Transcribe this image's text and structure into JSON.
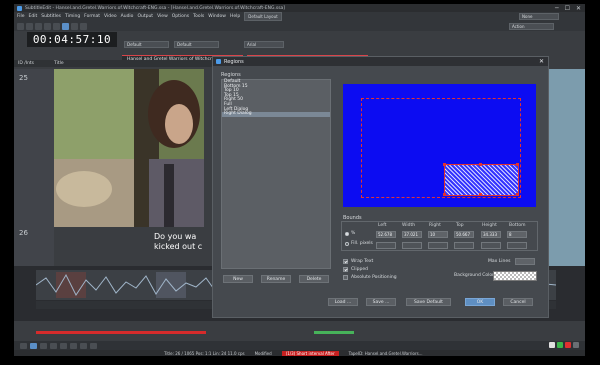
{
  "window": {
    "title": "SubtitleEdit - Hansel.and.Gretel.Warriors.of.Witchcraft-ENG.ssa - [Hansel.and.Gretel.Warriors.of.Witchcraft-ENG.ssa]",
    "minimize": "─",
    "maximize": "☐",
    "close": "✕"
  },
  "menu": {
    "items": [
      "File",
      "Edit",
      "Subtitles",
      "Timing",
      "Format",
      "Video",
      "Audio",
      "Output",
      "View",
      "Options",
      "Tools",
      "Window",
      "Help"
    ],
    "layout_select": "Default Layout",
    "right_select": "None",
    "action_select": "Action"
  },
  "timecode": "00:04:57:10",
  "tabs": [
    "Hansel and Gretel Warriors of Witchcraft-ENG.ssa",
    "Hansel and Gretel Warriors of Witchcraft-ENG.ssa"
  ],
  "style_selects": {
    "style": "Default",
    "font": "Default",
    "font_name": "Arial"
  },
  "grid_header": {
    "id": "ID /Ints",
    "title": "Title"
  },
  "rows": {
    "row1_num": "25",
    "row2_num": "26"
  },
  "subtitle_lines": {
    "line1": "Do you wa",
    "line2": "kicked out c"
  },
  "dialog": {
    "title": "Regions",
    "close": "✕",
    "regions_label": "Regions",
    "regions": [
      "Default",
      "Bottom 15",
      "Top 10",
      "Top 15",
      "Right 50",
      "Full",
      "Left Dialog",
      "Right Dialog"
    ],
    "selected_index": 7,
    "buttons": {
      "new": "New",
      "rename": "Rename",
      "delete": "Delete"
    },
    "bounds_label": "Bounds",
    "bounds_headers": [
      "Left",
      "Width",
      "Right",
      "Top",
      "Height",
      "Bottom"
    ],
    "mode_percent": "%",
    "mode_pixels": "Fill. pixels",
    "bounds_values": [
      "52.678",
      "37.021",
      "10",
      "50.667",
      "34.333",
      "8"
    ],
    "wrap_text": "Wrap Text",
    "clipped": "Clipped",
    "absolute_positioning": "Absolute Positioning",
    "max_lines": "Max Lines",
    "max_lines_value": "",
    "background_color": "Background Color",
    "footer": {
      "load": "Load ...",
      "save": "Save ...",
      "save_default": "Save Default",
      "ok": "OK",
      "cancel": "Cancel"
    }
  },
  "statusbar": {
    "title": "Title: 26 / 1065  Pos: 1:1  Lin: 24  11.0 cps",
    "modified": "Modified",
    "error": "(1/3) Short interval After",
    "file": "TapeID: Hansel.and.Gretel.Warriors..."
  },
  "colors": {
    "accent": "#5b8fc7",
    "preview_bg": "#0c0cf2",
    "error": "#c62020"
  }
}
